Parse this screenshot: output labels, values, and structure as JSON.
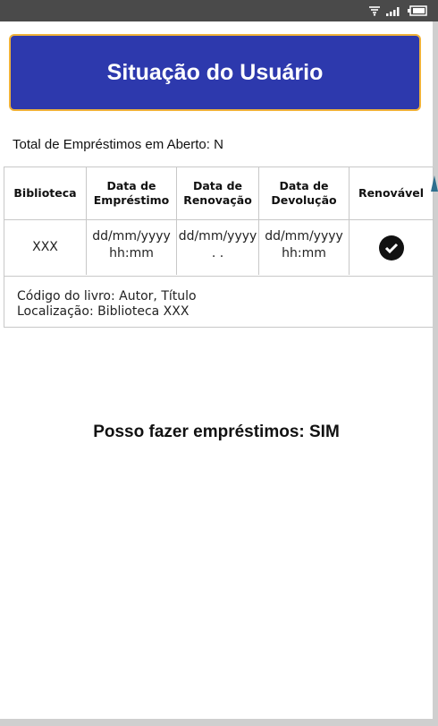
{
  "header": {
    "title": "Situação do Usuário"
  },
  "summary": {
    "total_open_loans": "Total de Empréstimos em Aberto: N"
  },
  "table": {
    "columns": [
      "Biblioteca",
      "Data de Empréstimo",
      "Data de Renovação",
      "Data de Devolução",
      "Renovável"
    ],
    "rows": [
      {
        "library": "XXX",
        "loan_date": "dd/mm/yyyy hh:mm",
        "renewal_date": "dd/mm/yyyy . .",
        "return_date": "dd/mm/yyyy hh:mm",
        "renewable_icon": "check-circle-icon"
      }
    ],
    "book": {
      "code_line": "Código do livro: Autor, Título",
      "location_line": "Localização: Biblioteca XXX"
    }
  },
  "footer": {
    "can_loan": "Posso fazer empréstimos: SIM"
  },
  "colors": {
    "header_bg": "#2d39ad",
    "header_border": "#f0b23a",
    "status_bar": "#4a4a4a"
  }
}
